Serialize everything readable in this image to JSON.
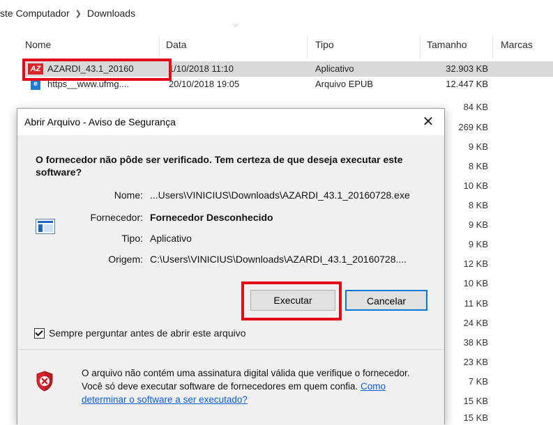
{
  "breadcrumb": {
    "items": [
      "ste Computador",
      "Downloads"
    ]
  },
  "columns": {
    "name": "Nome",
    "date": "Data",
    "type": "Tipo",
    "size": "Tamanho",
    "tags": "Marcas"
  },
  "files": [
    {
      "name": "AZARDI_43.1_20160",
      "date": "1/10/2018 11:10",
      "type": "Aplicativo",
      "size": "32.903 KB",
      "icon": "azardi-icon",
      "selected": true
    },
    {
      "name": "https__www.ufmg....",
      "date": "20/10/2018 19:05",
      "type": "Arquivo EPUB",
      "size": "12.447 KB",
      "icon": "epub-icon"
    }
  ],
  "side_sizes": [
    "84 KB",
    "269 KB",
    "9 KB",
    "8 KB",
    "10 KB",
    "8 KB",
    "9 KB",
    "9 KB",
    "12 KB",
    "10 KB",
    "11 KB",
    "24 KB",
    "38 KB",
    "23 KB",
    "7 KB",
    "15 KB",
    "15 KB"
  ],
  "dialog": {
    "title": "Abrir Arquivo - Aviso de Segurança",
    "close_glyph": "✕",
    "warning": "O fornecedor não pôde ser verificado. Tem certeza de que deseja executar este software?",
    "fields": {
      "name_label": "Nome:",
      "name_value": "...Users\\VINICIUS\\Downloads\\AZARDI_43.1_20160728.exe",
      "publisher_label": "Fornecedor:",
      "publisher_value": "Fornecedor Desconhecido",
      "type_label": "Tipo:",
      "type_value": "Aplicativo",
      "origin_label": "Origem:",
      "origin_value": "C:\\Users\\VINICIUS\\Downloads\\AZARDI_43.1_20160728...."
    },
    "run_button": "Executar",
    "cancel_button": "Cancelar",
    "always_ask": "Sempre perguntar antes de abrir este arquivo",
    "always_ask_checked": true,
    "footer_text": "O arquivo não contém uma assinatura digital válida que verifique o fornecedor. Você só deve executar software de fornecedores em quem confia.",
    "footer_link": "Como determinar o software a ser executado?"
  },
  "colors": {
    "highlight_red": "#e30b17",
    "accent_blue": "#0078d7",
    "link_blue": "#0a5bd3"
  }
}
